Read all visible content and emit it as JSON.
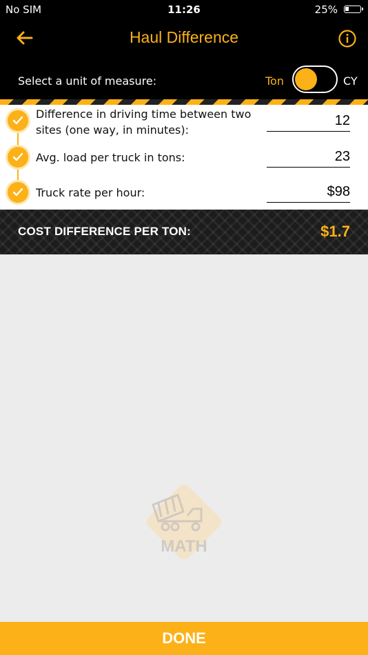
{
  "status_bar": {
    "carrier": "No SIM",
    "time": "11:26",
    "battery": "25%"
  },
  "nav": {
    "title": "Haul Difference",
    "back_icon": "back-arrow-icon",
    "info_icon": "info-icon"
  },
  "unit_selector": {
    "label": "Select a unit of measure:",
    "option_left": "Ton",
    "option_right": "CY",
    "selected": "Ton"
  },
  "form": {
    "rows": [
      {
        "label_line1": "Difference in driving time between two",
        "label_line2": "sites (one way, in minutes):",
        "value": "12"
      },
      {
        "label": "Avg. load per truck in tons:",
        "value": "23"
      },
      {
        "label": "Truck rate per hour:",
        "value": "$98"
      }
    ]
  },
  "result": {
    "label": "COST DIFFERENCE PER TON:",
    "value": "$1.7"
  },
  "watermark": {
    "text": "MATH"
  },
  "done_label": "DONE",
  "colors": {
    "accent": "#fbb117",
    "bar": "#000000",
    "background": "#ececec"
  }
}
